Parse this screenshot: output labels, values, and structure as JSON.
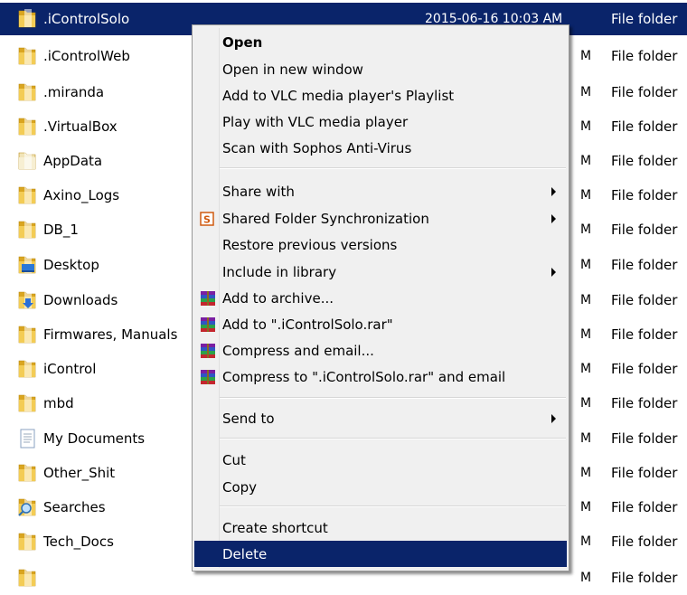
{
  "files": [
    {
      "name": ".iControlSolo",
      "date": "2015-06-16 10:03 AM",
      "type": "File folder",
      "icon": "folder-icon"
    },
    {
      "name": ".iControlWeb",
      "date": "",
      "type": "File folder",
      "icon": "folder-icon"
    },
    {
      "name": ".miranda",
      "date": "",
      "type": "File folder",
      "icon": "folder-icon"
    },
    {
      "name": ".VirtualBox",
      "date": "",
      "type": "File folder",
      "icon": "folder-icon"
    },
    {
      "name": "AppData",
      "date": "",
      "type": "File folder",
      "icon": "faded-folder-icon"
    },
    {
      "name": "Axino_Logs",
      "date": "",
      "type": "File folder",
      "icon": "folder-icon"
    },
    {
      "name": "DB_1",
      "date": "",
      "type": "File folder",
      "icon": "folder-icon"
    },
    {
      "name": "Desktop",
      "date": "",
      "type": "File folder",
      "icon": "desktop-folder-icon"
    },
    {
      "name": "Downloads",
      "date": "",
      "type": "File folder",
      "icon": "downloads-folder-icon"
    },
    {
      "name": "Firmwares, Manuals",
      "date": "",
      "type": "File folder",
      "icon": "folder-icon"
    },
    {
      "name": "iControl",
      "date": "",
      "type": "File folder",
      "icon": "folder-icon"
    },
    {
      "name": "mbd",
      "date": "",
      "type": "File folder",
      "icon": "folder-icon"
    },
    {
      "name": "My Documents",
      "date": "",
      "type": "File folder",
      "icon": "documents-icon"
    },
    {
      "name": "Other_Shit",
      "date": "",
      "type": "File folder",
      "icon": "folder-icon"
    },
    {
      "name": "Searches",
      "date": "",
      "type": "File folder",
      "icon": "searches-icon"
    },
    {
      "name": "Tech_Docs",
      "date": "",
      "type": "File folder",
      "icon": "folder-icon"
    },
    {
      "name": "",
      "date": "",
      "type": "File folder",
      "icon": "folder-icon"
    }
  ],
  "date_fragments": [
    "M",
    "M",
    "M",
    "M",
    "M",
    "M",
    "M",
    "M",
    "M",
    "M",
    "M",
    "M",
    "M",
    "M",
    "M",
    "M"
  ],
  "menu": {
    "items": [
      {
        "label": "Open",
        "bold": true,
        "icon": "",
        "submenu": false
      },
      {
        "label": "Open in new window",
        "icon": "",
        "submenu": false
      },
      {
        "label": "Add to VLC media player's Playlist",
        "icon": "",
        "submenu": false
      },
      {
        "label": "Play with VLC media player",
        "icon": "",
        "submenu": false
      },
      {
        "label": "Scan with Sophos Anti-Virus",
        "icon": "",
        "submenu": false
      },
      {
        "label": "Share with",
        "icon": "",
        "submenu": true
      },
      {
        "label": "Shared Folder Synchronization",
        "icon": "sync-icon",
        "submenu": true
      },
      {
        "label": "Restore previous versions",
        "icon": "",
        "submenu": false
      },
      {
        "label": "Include in library",
        "icon": "",
        "submenu": true
      },
      {
        "label": "Add to archive...",
        "icon": "winrar-icon",
        "submenu": false
      },
      {
        "label": "Add to \".iControlSolo.rar\"",
        "icon": "winrar-icon",
        "submenu": false
      },
      {
        "label": "Compress and email...",
        "icon": "winrar-icon",
        "submenu": false
      },
      {
        "label": "Compress to \".iControlSolo.rar\" and email",
        "icon": "winrar-icon",
        "submenu": false
      },
      {
        "label": "Send to",
        "icon": "",
        "submenu": true
      },
      {
        "label": "Cut",
        "icon": "",
        "submenu": false
      },
      {
        "label": "Copy",
        "icon": "",
        "submenu": false
      },
      {
        "label": "Create shortcut",
        "icon": "",
        "submenu": false
      },
      {
        "label": "Delete",
        "icon": "",
        "submenu": false,
        "highlighted": true
      }
    ]
  },
  "colors": {
    "selection": "#0a246a",
    "folder": "#e8b830"
  }
}
